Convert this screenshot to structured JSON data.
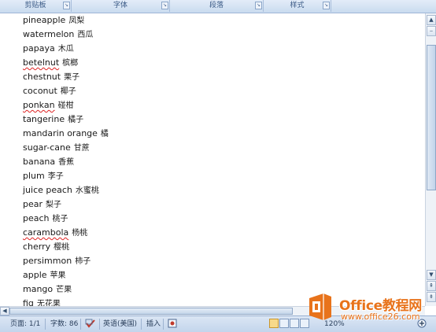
{
  "ribbon": {
    "groups": [
      {
        "label": "剪贴板"
      },
      {
        "label": "字体"
      },
      {
        "label": "段落"
      },
      {
        "label": "样式"
      }
    ]
  },
  "document": {
    "lines": [
      {
        "en": "pineapple",
        "zh": "凤梨",
        "spellcheck": false
      },
      {
        "en": "watermelon",
        "zh": "西瓜",
        "spellcheck": false
      },
      {
        "en": "papaya",
        "zh": "木瓜",
        "spellcheck": false
      },
      {
        "en": "betelnut",
        "zh": "槟榔",
        "spellcheck": true
      },
      {
        "en": "chestnut",
        "zh": "栗子",
        "spellcheck": false
      },
      {
        "en": "coconut",
        "zh": "椰子",
        "spellcheck": false
      },
      {
        "en": "ponkan",
        "zh": "碰柑",
        "spellcheck": true
      },
      {
        "en": "tangerine",
        "zh": "橘子",
        "spellcheck": false
      },
      {
        "en": "mandarin orange",
        "zh": "橘",
        "spellcheck": false
      },
      {
        "en": "sugar-cane",
        "zh": "甘蔗",
        "spellcheck": false
      },
      {
        "en": "banana",
        "zh": "香蕉",
        "spellcheck": false
      },
      {
        "en": "plum",
        "zh": "李子",
        "spellcheck": false
      },
      {
        "en": "juice peach",
        "zh": "水蜜桃",
        "spellcheck": false
      },
      {
        "en": "pear",
        "zh": "梨子",
        "spellcheck": false
      },
      {
        "en": "peach",
        "zh": "桃子",
        "spellcheck": false
      },
      {
        "en": "carambola",
        "zh": "杨桃",
        "spellcheck": true
      },
      {
        "en": "cherry",
        "zh": "樱桃",
        "spellcheck": false
      },
      {
        "en": "persimmon",
        "zh": "柿子",
        "spellcheck": false
      },
      {
        "en": "apple",
        "zh": "苹果",
        "spellcheck": false
      },
      {
        "en": "mango",
        "zh": "芒果",
        "spellcheck": false
      },
      {
        "en": "fig",
        "zh": "无花果",
        "spellcheck": false
      }
    ]
  },
  "status": {
    "page": "页面: 1/1",
    "words": "字数: 86",
    "language": "英语(美国)",
    "mode": "插入",
    "zoom": "120%"
  },
  "watermark": {
    "title": "Office教程网",
    "url": "www.office26.com"
  },
  "colors": {
    "ribbon_text": "#3b5a86",
    "statusbar_bg": "#c3d5ec",
    "spell_error": "#dd2222",
    "watermark": "#e8731b"
  }
}
